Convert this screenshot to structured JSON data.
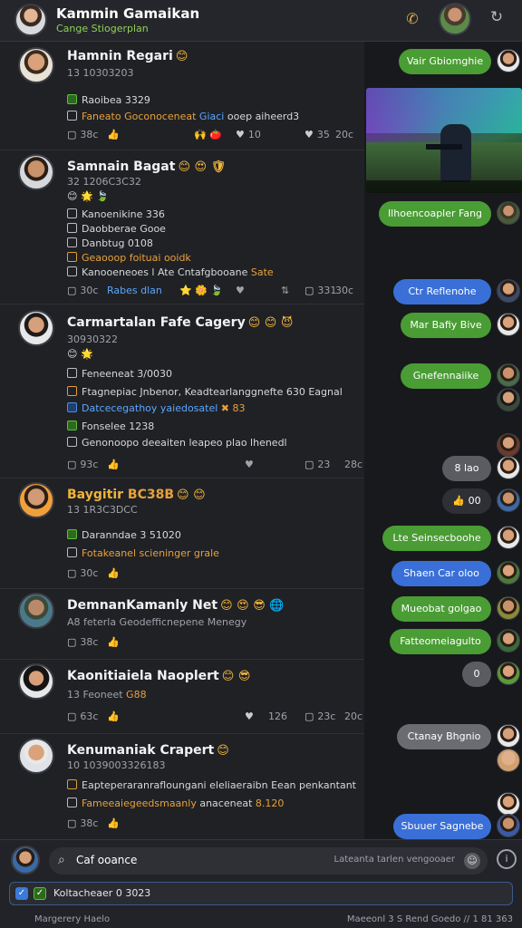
{
  "header": {
    "title": "Kammin Gamaikan",
    "subtitle": "Cange Stiogerplan",
    "icons": [
      "phone-icon",
      "refresh-icon"
    ]
  },
  "posts": [
    {
      "name": "Hamnin Regari",
      "emoji": "😊",
      "meta": "13 10303203",
      "lines": [
        {
          "type": "checked",
          "text": "Raoibea 3329"
        },
        {
          "type": "plain",
          "text": "Faneato Goconoceneat",
          "extra": "Giaci",
          "extra2": "ooep aiheerd3"
        }
      ],
      "actions": {
        "comments": "38c",
        "likes": "10",
        "views": "35",
        "shares": "20c"
      }
    },
    {
      "name": "Samnain Bagat",
      "emoji": "😊 😍 🛡",
      "meta": "32 1206C3C32",
      "lines": [
        {
          "type": "icons",
          "text": "😊 🌟 🍃"
        },
        {
          "type": "plain",
          "text": "Kanoenikine 336"
        },
        {
          "type": "plain",
          "text": "Daobberae Gooe"
        },
        {
          "type": "plain",
          "text": "Danbtug 0108"
        },
        {
          "type": "orange",
          "text": "Geaooop foituai ooidk"
        },
        {
          "type": "plain",
          "text": "Kanooeneoes l Ate Cntafgbooane",
          "extra": "Sate"
        }
      ],
      "actions": {
        "comments": "30c",
        "tag": "Rabes dlan",
        "views": "331",
        "shares": "30c"
      }
    },
    {
      "name": "Carmartalan Fafe Cagery",
      "emoji": "😊 😊 😈",
      "meta": "30930322",
      "lines": [
        {
          "type": "icons",
          "text": "😊 🌟"
        },
        {
          "type": "plain",
          "text": "Feneeneat 3/0030"
        },
        {
          "type": "orange",
          "text": "Ftagnepiac Jnbenor, Keadtearlanggnefte 630 Eagnal"
        },
        {
          "type": "blue",
          "text": "Datcecegathoy yaiedosatel",
          "extra": "83"
        },
        {
          "type": "plain",
          "text": "Fonselee 1238"
        },
        {
          "type": "plain",
          "text": "Genonoopo deeaiten leapeo plao lhenedl"
        }
      ],
      "actions": {
        "comments": "93c",
        "views": "23",
        "shares": "28c"
      }
    },
    {
      "name": "Baygitir",
      "highlight": "BC38B",
      "emoji": "😊 😊",
      "meta": "13 1R3C3DCC",
      "lines": [
        {
          "type": "checked",
          "text": "Daranndae 3 51020"
        },
        {
          "type": "orange",
          "text": "Fotakeanel scieninger grale"
        }
      ],
      "actions": {
        "comments": "30c"
      }
    },
    {
      "name": "DemnanKamanly Net",
      "emoji": "😊 😍 😎 🌐",
      "meta": "A8 feterla Geodefficnepene Menegy",
      "lines": [],
      "actions": {
        "comments": "38c"
      }
    },
    {
      "name": "Kaonitiaiela Naoplert",
      "emoji": "😊 😎",
      "meta": "13 Feoneet",
      "meta_highlight": "G88",
      "lines": [],
      "actions": {
        "comments": "63c",
        "views": "126",
        "shares": "23c",
        "extra": "20c"
      }
    },
    {
      "name": "Kenumaniak Crapert",
      "emoji": "😊",
      "meta": "10 1039003326183",
      "lines": [
        {
          "type": "orange",
          "text": "Eapteperaranrafloungani eleliaeraibn Eean penkantant"
        },
        {
          "type": "orange",
          "text": "Fameeaiegeedsmaanly",
          "extra": "anaceneat",
          "extra2": "8.120"
        }
      ],
      "actions": {
        "comments": "38c"
      }
    }
  ],
  "chat": {
    "messages": [
      {
        "text": "Vair Gbiomghie",
        "color": "green"
      },
      {
        "text": "Ilhoencoapler Fang",
        "color": "green"
      },
      {
        "text": "Ctr Reflenohe",
        "color": "blue"
      },
      {
        "text": "Mar Bafiy Bive",
        "color": "green"
      },
      {
        "text": "Gnefennaiike",
        "color": "green"
      },
      {
        "text": "8 lao",
        "color": "gray"
      },
      {
        "text": "00",
        "color": "dark"
      },
      {
        "text": "Lte Seinsecboohe",
        "color": "green"
      },
      {
        "text": "Shaen Car oloo",
        "color": "blue"
      },
      {
        "text": "Mueobat golgao",
        "color": "green"
      },
      {
        "text": "Fatteomeiagulto",
        "color": "green"
      },
      {
        "text": "0",
        "color": "gray"
      },
      {
        "text": "Ctanay Bhgnio",
        "color": "gray"
      },
      {
        "text": "Sbuuer Sagnebe",
        "color": "blue"
      }
    ]
  },
  "bottom": {
    "search_text": "Caf ooance",
    "search_placeholder": "Lateanta tarlen vengooaer",
    "input_text": "Koltacheaer 0 3023",
    "footer_left": "Margerery Haelo",
    "footer_right": "Maeeonl 3 S Rend Goedo // 1 81 363"
  }
}
